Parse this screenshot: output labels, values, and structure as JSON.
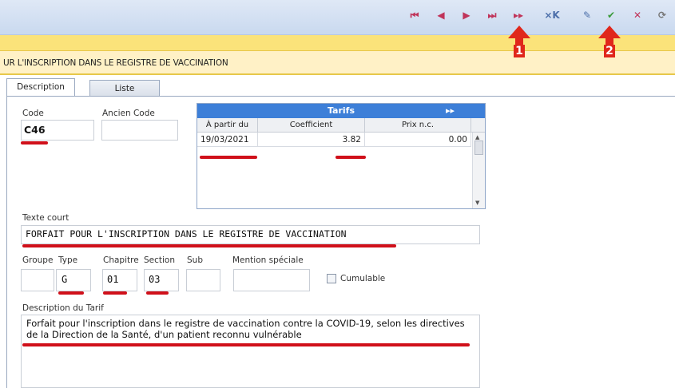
{
  "toolbar": {
    "buttons": [
      {
        "name": "first-record",
        "glyph": "⏮"
      },
      {
        "name": "prev-record",
        "glyph": "◀"
      },
      {
        "name": "next-record",
        "glyph": "▶"
      },
      {
        "name": "last-record",
        "glyph": "⏭"
      },
      {
        "name": "fast-forward",
        "glyph": "▸▸"
      },
      {
        "name": "delete-record",
        "glyph": "⨯K"
      },
      {
        "name": "edit",
        "glyph": "✎"
      },
      {
        "name": "confirm",
        "glyph": "✔"
      },
      {
        "name": "cancel",
        "glyph": "✕"
      },
      {
        "name": "refresh",
        "glyph": "⟳"
      }
    ]
  },
  "annotations": {
    "arrow1": "1",
    "arrow2": "2"
  },
  "header": {
    "title": "UR L'INSCRIPTION DANS LE REGISTRE DE VACCINATION"
  },
  "tabs": [
    {
      "label": "Description"
    },
    {
      "label": "Liste"
    }
  ],
  "form": {
    "code_label": "Code",
    "code_value": "C46",
    "ancien_code_label": "Ancien Code",
    "ancien_code_value": "",
    "texte_court_label": "Texte court",
    "texte_court_value": "FORFAIT POUR L'INSCRIPTION DANS LE REGISTRE DE VACCINATION",
    "groupe_label": "Groupe",
    "groupe_value": "",
    "type_label": "Type",
    "type_value": "G",
    "chapitre_label": "Chapitre",
    "chapitre_value": "01",
    "section_label": "Section",
    "section_value": "03",
    "sub_label": "Sub",
    "sub_value": "",
    "mention_label": "Mention spéciale",
    "mention_value": "",
    "cumulable_label": "Cumulable",
    "cumulable_checked": false,
    "description_label": "Description du Tarif",
    "description_value": "Forfait pour l'inscription dans le registre de vaccination contre la COVID-19, selon les directives de la Direction de la Santé, d'un patient reconnu vulnérable"
  },
  "tarifs": {
    "title": "Tarifs",
    "columns": [
      "À partir du",
      "Coefficient",
      "Prix n.c."
    ],
    "rows": [
      {
        "date": "19/03/2021",
        "coefficient": "3.82",
        "prix": "0.00"
      }
    ]
  },
  "colors": {
    "accent_red": "#d0101a",
    "header_blue": "#3d7fd8",
    "yellow": "#fbe37a"
  }
}
